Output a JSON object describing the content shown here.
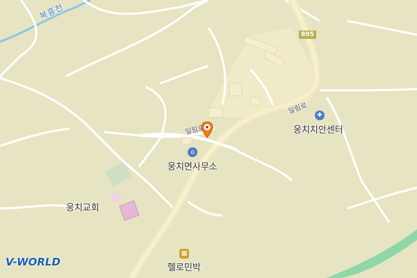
{
  "map": {
    "route_badge": "895",
    "river_label": "복흥천",
    "roads": [
      {
        "label": "일림로"
      },
      {
        "label": "일림로"
      }
    ],
    "places": [
      {
        "name": "웅치면사무소",
        "icon": "office-icon"
      },
      {
        "name": "웅치치안센터",
        "icon": "police-icon"
      },
      {
        "name": "웅치교회",
        "icon": "church"
      },
      {
        "name": "헬로민박",
        "icon": "lodging-icon"
      }
    ],
    "marker": {
      "icon": "location-pin-icon",
      "color": "#f07d1e"
    },
    "logo": "V-WORLD",
    "colors": {
      "background": "#e6e4c2",
      "road_main": "#f4ebc4",
      "road_minor": "#ffffff",
      "water": "#7fd0a8",
      "river": "#8dc6e6",
      "building": "#f2e9c8",
      "poi_blue": "#4a7fc1",
      "poi_lodging": "#d2a12b"
    }
  }
}
